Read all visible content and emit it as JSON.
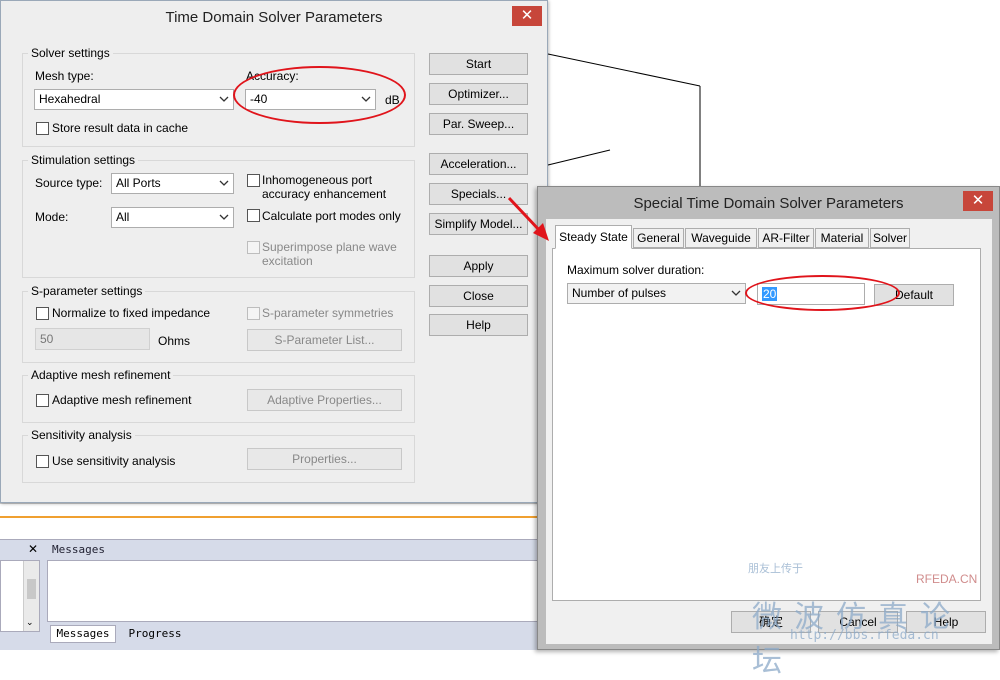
{
  "main_dialog": {
    "title": "Time Domain Solver Parameters",
    "close_glyph": "✕",
    "solver_settings": {
      "group_label": "Solver settings",
      "mesh_type_label": "Mesh type:",
      "mesh_type_value": "Hexahedral",
      "accuracy_label": "Accuracy:",
      "accuracy_value": "-40",
      "accuracy_unit": "dB",
      "store_cache_label": "Store result data in cache"
    },
    "stimulation_settings": {
      "group_label": "Stimulation settings",
      "source_type_label": "Source type:",
      "source_type_value": "All Ports",
      "mode_label": "Mode:",
      "mode_value": "All",
      "inhomogeneous_line1": "Inhomogeneous port",
      "inhomogeneous_line2": "accuracy enhancement",
      "calc_port_modes_label": "Calculate port modes only",
      "superimpose_line1": "Superimpose plane wave",
      "superimpose_line2": "excitation"
    },
    "sparam_settings": {
      "group_label": "S-parameter settings",
      "normalize_label": "Normalize to fixed impedance",
      "symmetries_label": "S-parameter symmetries",
      "impedance_value": "50",
      "impedance_unit": "Ohms",
      "list_button": "S-Parameter List..."
    },
    "adaptive_mesh": {
      "group_label": "Adaptive mesh refinement",
      "checkbox_label": "Adaptive mesh refinement",
      "properties_button": "Adaptive Properties..."
    },
    "sensitivity": {
      "group_label": "Sensitivity analysis",
      "checkbox_label": "Use sensitivity analysis",
      "properties_button": "Properties..."
    },
    "buttons": {
      "start": "Start",
      "optimizer": "Optimizer...",
      "par_sweep": "Par. Sweep...",
      "acceleration": "Acceleration...",
      "specials": "Specials...",
      "simplify": "Simplify Model...",
      "apply": "Apply",
      "close": "Close",
      "help": "Help"
    }
  },
  "messages_panel": {
    "close_glyph": "✕",
    "title": "Messages",
    "tabs": [
      "Messages",
      "Progress"
    ]
  },
  "special_dialog": {
    "title": "Special Time Domain Solver Parameters",
    "close_glyph": "✕",
    "tabs": [
      "Steady State",
      "General",
      "Waveguide",
      "AR-Filter",
      "Material",
      "Solver"
    ],
    "max_duration_label": "Maximum solver duration:",
    "duration_type_value": "Number of pulses",
    "duration_value": "20",
    "default_button": "Default",
    "ok_button": "确定",
    "cancel_button": "Cancel",
    "help_button": "Help"
  },
  "watermark": {
    "line1": "微波仿真论坛",
    "url": "http://bbs.rfeda.cn",
    "brand": "RFEDA.CN",
    "small": "朋友上传于"
  },
  "colors": {
    "highlight_red": "#e0141b",
    "close_red": "#c7463a",
    "selection_blue": "#3399ff"
  }
}
